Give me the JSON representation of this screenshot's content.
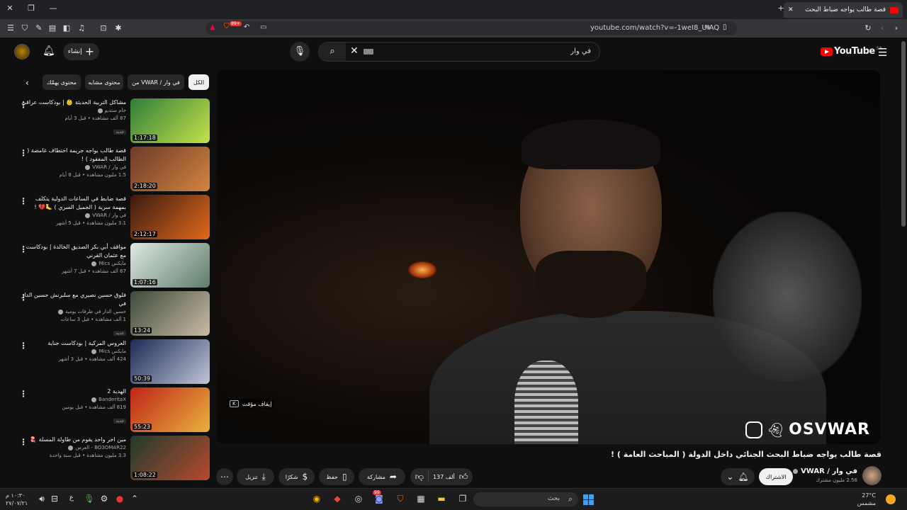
{
  "browser": {
    "tab_title": "قصة طالب يواجه ضباط البحث",
    "url": "youtube.com/watch?v=-1weI8_UIAQ",
    "shield_badge": "99+"
  },
  "header": {
    "create_label": "إنشاء",
    "search_value": "في وار",
    "logo_text": "YouTube",
    "logo_region": "SA"
  },
  "chips": [
    {
      "label": "الكل",
      "active": true
    },
    {
      "label": "من VWAR / في وار",
      "active": false
    },
    {
      "label": "محتوى مشابه",
      "active": false
    },
    {
      "label": "محتوى يهمّك",
      "active": false
    }
  ],
  "recommendations": [
    {
      "title": "مشاكل التربية الحديثة 👶 | بودكاست عراقي",
      "channel": "جام ستديو",
      "views": "87 ألف مشاهدة • قبل 3 أيام",
      "duration": "1:17:18",
      "new": "جديد",
      "thumb_colors": [
        "#2f7d3a",
        "#c4e24a"
      ]
    },
    {
      "title": "قصة طالب يواجه جريمة اختطاف غامضة ( الطالب المفقود ) !",
      "channel": "في وار / VWAR",
      "views": "1.5 مليون مشاهدة • قبل 8 أيام",
      "duration": "2:18:20",
      "new": "",
      "thumb_colors": [
        "#6b3b2a",
        "#d3843f"
      ]
    },
    {
      "title": "قصة ضابط في الساعات الدولية يتكلف بمهمة سرية ( الجميل السري ) 🦶💔 !",
      "channel": "في وار / VWAR",
      "views": "3.1 مليون مشاهدة • قبل 5 أشهر",
      "duration": "2:12:17",
      "new": "",
      "thumb_colors": [
        "#3a1a10",
        "#e06a1b"
      ]
    },
    {
      "title": "مواقف أبي بكر الصديق الخالدة | بودكاست مع عثمان القرني",
      "channel": "مايكس Mics",
      "views": "67 ألف مشاهدة • قبل 7 أشهر",
      "duration": "1:07:16",
      "new": "",
      "thumb_colors": [
        "#dfe9e3",
        "#5e7d6a"
      ]
    },
    {
      "title": "فلوق حسين نصيري مع سلبرنش حسين الدار في",
      "channel": "حسين الدار في ظرفات يومية",
      "views": "1 ألف مشاهدة • قبل 3 ساعات",
      "duration": "13:24",
      "new": "جديد",
      "thumb_colors": [
        "#3c4a3a",
        "#c9bba4"
      ]
    },
    {
      "title": "العروس المركبة | بودكاست جناية",
      "channel": "مايكس Mics",
      "views": "424 ألف مشاهدة • قبل 3 أشهر",
      "duration": "50:39",
      "new": "",
      "thumb_colors": [
        "#1b2a55",
        "#c0c6d8"
      ]
    },
    {
      "title": "الهدية 2",
      "channel": "BanderitaX",
      "views": "819 ألف مشاهدة • قبل يومين",
      "duration": "55:23",
      "new": "جديد",
      "thumb_colors": [
        "#c0241b",
        "#e8b23c"
      ]
    },
    {
      "title": "مين اخر واحد يقوم من طاولة المسلة 🪼",
      "channel": "BO3OMAR22 - العرس",
      "views": "3.3 مليون مشاهدة • قبل سنة واحدة",
      "duration": "1:08:22",
      "new": "",
      "thumb_colors": [
        "#1e3b2a",
        "#b8492f"
      ]
    }
  ],
  "player": {
    "watermark": "OSVWAR",
    "pause_hint": "إيقاف مؤقت",
    "pause_key": "K"
  },
  "video": {
    "title": "قصة طالب يواجه ضباط البحث الجنائي داخل الدولة ( المباحث العامة ) !",
    "channel_name": "في وار / VWAR",
    "subscribers": "2.56 مليون مشترك",
    "subscribe_label": "الاشتراك",
    "likes": "137 ألف",
    "share_label": "مشاركة",
    "save_label": "حفظ",
    "thanks_label": "شكرًا",
    "download_label": "تنزيل"
  },
  "taskbar": {
    "time": "١٠:٣٠ م",
    "date": "٢٧/٠٧/٢١",
    "lang": "ع",
    "search_label": "بحث",
    "temperature": "27°C",
    "weather": "مشمس",
    "brave_badge": "99"
  }
}
